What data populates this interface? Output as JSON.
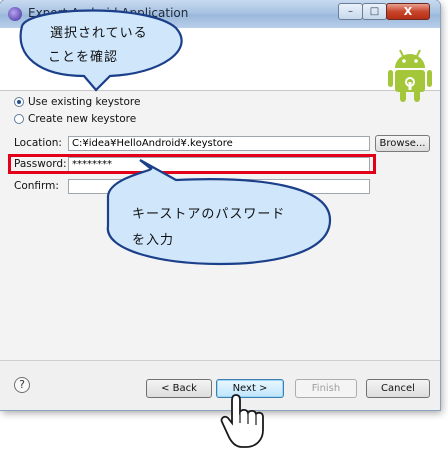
{
  "window": {
    "title": "Export Android Application",
    "min_glyph": "–",
    "max_glyph": "□",
    "close_glyph": "X"
  },
  "callouts": {
    "top_line1": "選択されている",
    "top_line2": "ことを確認",
    "mid_line1": "キーストアのパスワード",
    "mid_line2": "を入力"
  },
  "keystore": {
    "use_existing_label": "Use existing keystore",
    "create_new_label": "Create new keystore",
    "use_existing_selected": true
  },
  "form": {
    "location_label": "Location:",
    "location_value": "C:¥idea¥HelloAndroid¥.keystore",
    "browse_label": "Browse...",
    "password_label": "Password:",
    "password_value": "********",
    "confirm_label": "Confirm:",
    "confirm_value": ""
  },
  "footer": {
    "help_glyph": "?",
    "back_label": "< Back",
    "next_label": "Next >",
    "finish_label": "Finish",
    "cancel_label": "Cancel"
  },
  "colors": {
    "callout_fill": "#cfe6fb",
    "callout_stroke": "#1c3f8a",
    "highlight": "#e2001a",
    "android_green": "#a4c639"
  },
  "icons": [
    "window-app-icon",
    "android-logo-icon",
    "help-icon",
    "hand-cursor-icon"
  ]
}
